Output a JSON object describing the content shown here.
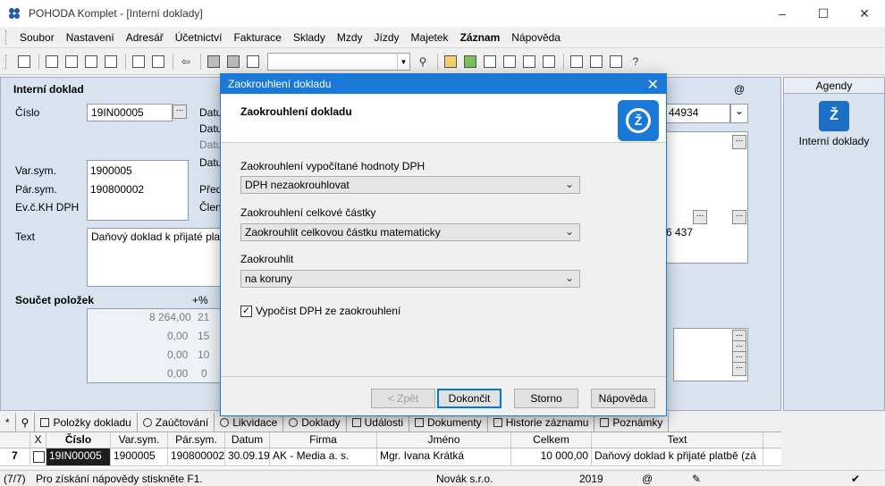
{
  "window": {
    "title": "POHODA Komplet - [Interní doklady]",
    "controls": [
      "–",
      "☐",
      "✕"
    ]
  },
  "menu": [
    "Soubor",
    "Nastavení",
    "Adresář",
    "Účetnictví",
    "Fakturace",
    "Sklady",
    "Mzdy",
    "Jízdy",
    "Majetek",
    "Záznam",
    "Nápověda"
  ],
  "form": {
    "heading": "Interní doklad",
    "cislo_label": "Číslo",
    "cislo_value": "19IN00005",
    "datum_labels": [
      "Datu",
      "Datu",
      "Datu",
      "Datu"
    ],
    "varsym_label": "Var.sym.",
    "varsym_value": "1900005",
    "parsym_label": "Pár.sym.",
    "parsym_value": "190800002",
    "evc_label": "Ev.č.KH DPH",
    "pred_label": "Před",
    "clen_label": "Člen",
    "text_label": "Text",
    "text_value": "Daňový doklad k přijaté plat",
    "right_field_value": "44934",
    "right_amount": "6 437",
    "at_sign": "@",
    "soucet_label": "Součet položek",
    "percent_label": "+%",
    "sum_rows": [
      {
        "amount": "8 264,00",
        "rate": "21"
      },
      {
        "amount": "0,00",
        "rate": "15"
      },
      {
        "amount": "0,00",
        "rate": "10"
      },
      {
        "amount": "0,00",
        "rate": "0"
      }
    ]
  },
  "agendy": {
    "header": "Agendy",
    "item": "Interní doklady"
  },
  "tabs": [
    "*",
    "Položky dokladu",
    "Zaúčtování",
    "Likvidace",
    "Doklady",
    "Události",
    "Dokumenty",
    "Historie záznamu",
    "Poznámky"
  ],
  "table": {
    "headers": [
      "",
      "X",
      "Číslo",
      "Var.sym.",
      "Pár.sym.",
      "Datum",
      "Firma",
      "Jméno",
      "Celkem",
      "Text"
    ],
    "row": {
      "index": "7",
      "cislo": "19IN00005",
      "varsym": "1900005",
      "parsym": "190800002",
      "datum": "30.09.19",
      "firma": "AK - Media a. s.",
      "jmeno": "Mgr. Ivana Krátká",
      "celkem": "10 000,00",
      "text": "Daňový doklad k přijaté platbě (zá"
    }
  },
  "statusbar": {
    "count": "(7/7)",
    "hint": "Pro získání nápovědy stiskněte F1.",
    "company": "Novák s.r.o.",
    "year": "2019",
    "at": "@"
  },
  "dialog": {
    "title": "Zaokrouhlení dokladu",
    "header": "Zaokrouhlení dokladu",
    "label_dph": "Zaokrouhlení vypočítané hodnoty DPH",
    "value_dph": "DPH nezaokrouhlovat",
    "label_total": "Zaokrouhlení celkové částky",
    "value_total": "Zaokrouhlit celkovou částku matematicky",
    "label_round": "Zaokrouhlit",
    "value_round": "na koruny",
    "checkbox_label": "Vypočíst DPH ze zaokrouhlení",
    "checkbox_checked": true,
    "btn_back": "< Zpět",
    "btn_finish": "Dokončit",
    "btn_cancel": "Storno",
    "btn_help": "Nápověda"
  }
}
